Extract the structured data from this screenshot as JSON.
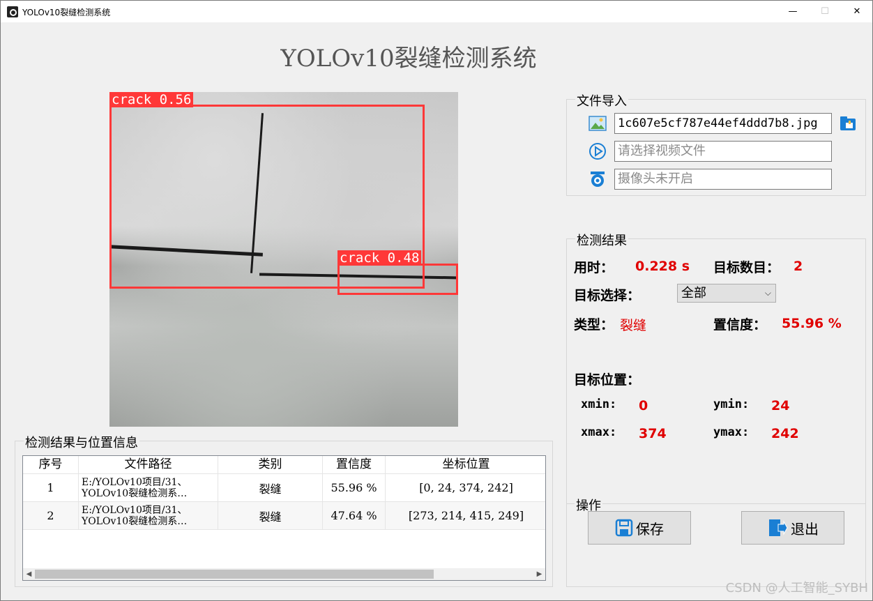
{
  "window": {
    "title": "YOLOv10裂缝检测系统",
    "minimize": "—",
    "maximize": "☐",
    "close": "✕"
  },
  "app_title": "YOLOv10裂缝检测系统",
  "detections_overlay": [
    {
      "label": "crack 0.56"
    },
    {
      "label": "crack 0.48"
    }
  ],
  "file_import": {
    "title": "文件导入",
    "image_value": "1c607e5cf787e44ef4ddd7b8.jpg",
    "video_placeholder": "请选择视频文件",
    "camera_placeholder": "摄像头未开启"
  },
  "results": {
    "title": "检测结果",
    "time_label": "用时：",
    "time_value": "0.228 s",
    "count_label": "目标数目：",
    "count_value": "2",
    "select_label": "目标选择：",
    "select_value": "全部",
    "type_label": "类型：",
    "type_value": "裂缝",
    "conf_label": "置信度：",
    "conf_value": "55.96 %",
    "position_label": "目标位置：",
    "xmin_label": "xmin:",
    "xmin_value": "0",
    "ymin_label": "ymin:",
    "ymin_value": "24",
    "xmax_label": "xmax:",
    "xmax_value": "374",
    "ymax_label": "ymax:",
    "ymax_value": "242"
  },
  "operations": {
    "title": "操作",
    "save_label": "保存",
    "exit_label": "退出"
  },
  "table": {
    "title": "检测结果与位置信息",
    "headers": [
      "序号",
      "文件路径",
      "类别",
      "置信度",
      "坐标位置"
    ],
    "rows": [
      {
        "index": "1",
        "path": "E:/YOLOv10项目/31、\nYOLOv10裂缝检测系…",
        "category": "裂缝",
        "confidence": "55.96 %",
        "coords": "[0, 24, 374, 242]"
      },
      {
        "index": "2",
        "path": "E:/YOLOv10项目/31、\nYOLOv10裂缝检测系…",
        "category": "裂缝",
        "confidence": "47.64 %",
        "coords": "[273, 214, 415, 249]"
      }
    ]
  },
  "watermark": "CSDN @人工智能_SYBH",
  "colors": {
    "accent_red": "#e00000",
    "bbox_red": "#ff3838",
    "icon_blue": "#1a7fd4"
  }
}
